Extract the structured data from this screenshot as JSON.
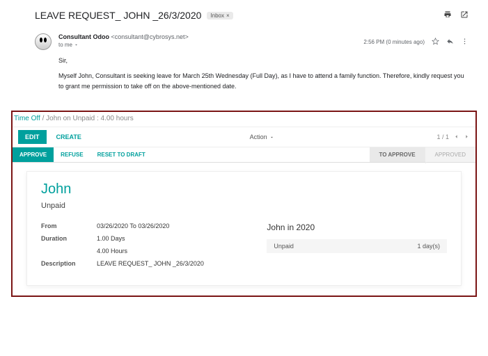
{
  "email": {
    "subject": "LEAVE REQUEST_ JOHN _26/3/2020",
    "inbox_chip": "Inbox",
    "from_name": "Consultant Odoo",
    "from_addr": "<consultant@cybrosys.net>",
    "to_line": "to me",
    "time": "2:56 PM (0 minutes ago)",
    "body_greeting": "Sir,",
    "body_text": "Myself John, Consultant is seeking leave for March 25th Wednesday  (Full Day), as I have to attend a family function. Therefore, kindly request you to grant me permission to take off on the above-mentioned date."
  },
  "odoo": {
    "breadcrumb_app": "Time Off",
    "breadcrumb_sep": " / ",
    "breadcrumb_record": "John on Unpaid : 4.00 hours",
    "edit": "EDIT",
    "create": "CREATE",
    "action": "Action",
    "pager": "1 / 1",
    "approve": "APPROVE",
    "refuse": "REFUSE",
    "reset": "RESET TO DRAFT",
    "status_to_approve": "TO APPROVE",
    "status_approved": "APPROVED",
    "form": {
      "title": "John",
      "subtitle": "Unpaid",
      "from_label": "From",
      "from_value": "03/26/2020 To 03/26/2020",
      "duration_label": "Duration",
      "duration_days": "1.00  Days",
      "duration_hours": "4.00  Hours",
      "description_label": "Description",
      "description_value": "LEAVE REQUEST_ JOHN _26/3/2020",
      "summary_title": "John in 2020",
      "summary_type": "Unpaid",
      "summary_days": "1 day(s)"
    }
  }
}
